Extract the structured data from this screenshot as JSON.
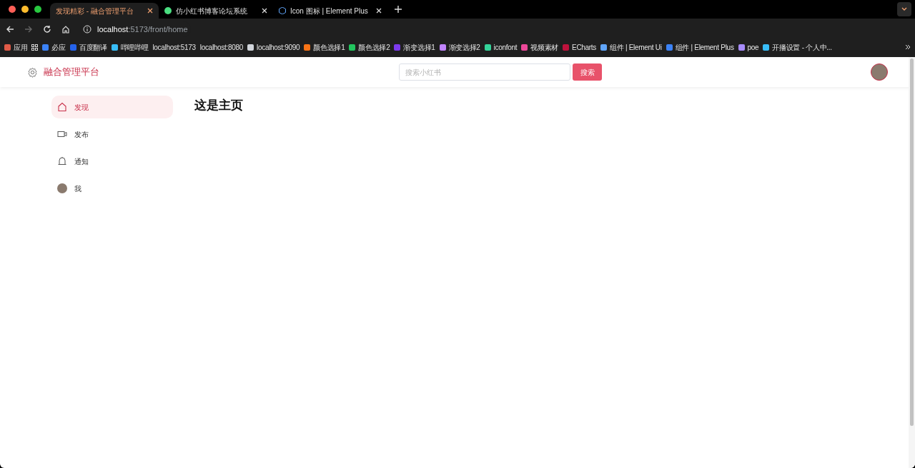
{
  "browser": {
    "tabs": [
      {
        "title": "发现精彩 - 融合管理平台",
        "selected": true
      },
      {
        "title": "仿小红书博客论坛系统",
        "selected": false,
        "kind": "site"
      },
      {
        "title": "Icon 图标 | Element Plus",
        "selected": false,
        "kind": "docs"
      }
    ],
    "address": {
      "host": "localhost",
      "path": ":5173/front/home"
    },
    "bookmarks": [
      {
        "label": "应用",
        "color": "#e05a47"
      },
      {
        "label": "必应",
        "color": "#3b82f6"
      },
      {
        "label": "百度翻译",
        "color": "#2563eb"
      },
      {
        "label": "哔哩哔哩",
        "color": "#38bdf8"
      },
      {
        "label": "localhost:5173"
      },
      {
        "label": "localhost:8080"
      },
      {
        "label": "localhost:9090",
        "color": "#d1d5db"
      },
      {
        "label": "颜色选择1",
        "color": "#f97316"
      },
      {
        "label": "颜色选择2",
        "color": "#22c55e"
      },
      {
        "label": "渐变选择1",
        "color": "#7c3aed"
      },
      {
        "label": "渐变选择2",
        "color": "#c084fc"
      },
      {
        "label": "iconfont",
        "color": "#34d399"
      },
      {
        "label": "视频素材",
        "color": "#ec4899"
      },
      {
        "label": "ECharts",
        "color": "#be123c"
      },
      {
        "label": "组件 | Element Ui",
        "color": "#60a5fa"
      },
      {
        "label": "组件 | Element Plus",
        "color": "#3b82f6"
      },
      {
        "label": "poe",
        "color": "#a78bfa"
      },
      {
        "label": "开播设置 - 个人中...",
        "color": "#38bdf8"
      }
    ]
  },
  "header": {
    "brand": "融合管理平台",
    "search": {
      "placeholder": "搜索小红书"
    },
    "search_button": "搜索"
  },
  "sidebar": {
    "items": [
      {
        "label": "发现",
        "kind": "home",
        "selected": true
      },
      {
        "label": "发布",
        "kind": "video",
        "selected": false
      },
      {
        "label": "通知",
        "kind": "bell",
        "selected": false
      },
      {
        "label": "我",
        "kind": "avatar",
        "selected": false
      }
    ]
  },
  "main": {
    "heading": "这是主页"
  }
}
